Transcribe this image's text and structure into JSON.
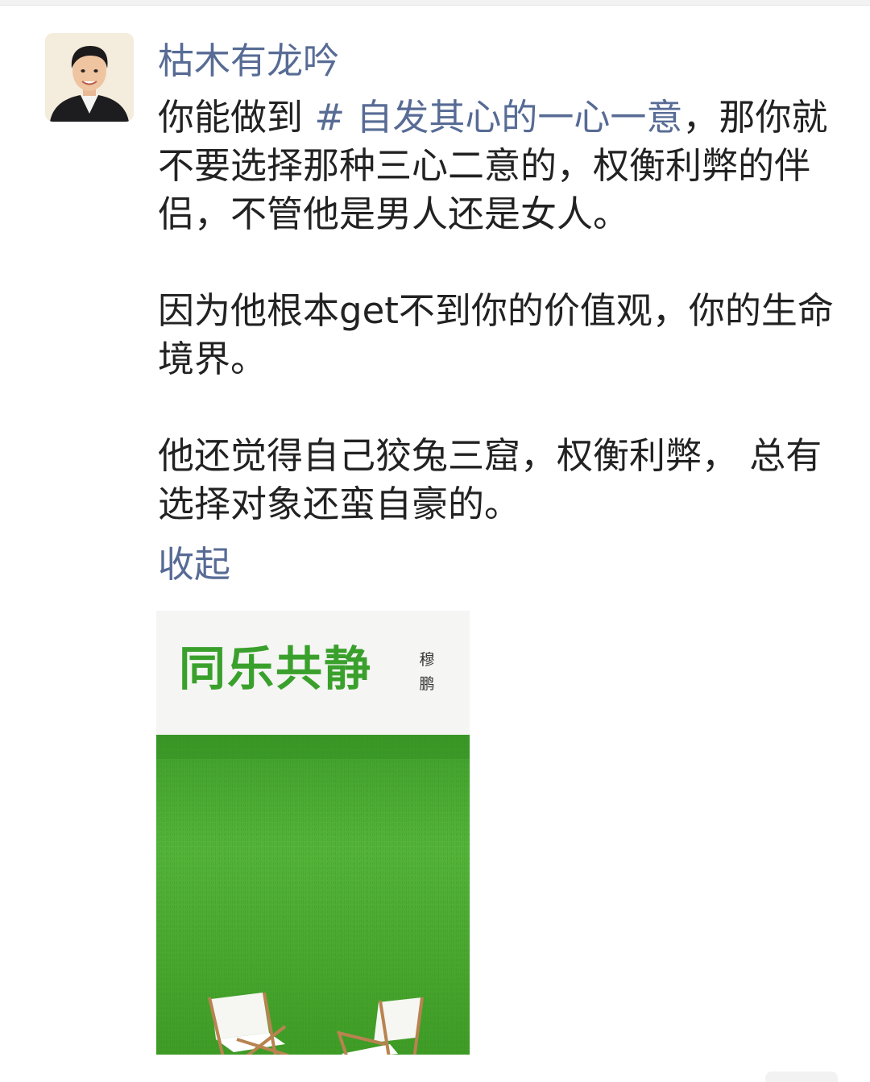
{
  "post": {
    "author": "枯木有龙吟",
    "paragraph1_before": "你能做到 ",
    "hashtag": "# 自发其心的一心一意",
    "paragraph1_after": "，那你就不要选择那种三心二意的，权衡利弊的伴侣，不管他是男人还是女人。",
    "paragraph2": "因为他根本get不到你的价值观，你的生命境界。",
    "paragraph3": "他还觉得自己狡兔三窟，权衡利弊， 总有选择对象还蛮自豪的。",
    "collapse_label": "收起"
  },
  "cover": {
    "title": "同乐共静",
    "author": "穆鹏"
  },
  "colors": {
    "link": "#576b95",
    "text": "#222222",
    "cover_title": "#3aa02c",
    "grass": "#4cae33"
  },
  "icons": {
    "avatar": "avatar-icon",
    "chairs": "chair-icon"
  }
}
